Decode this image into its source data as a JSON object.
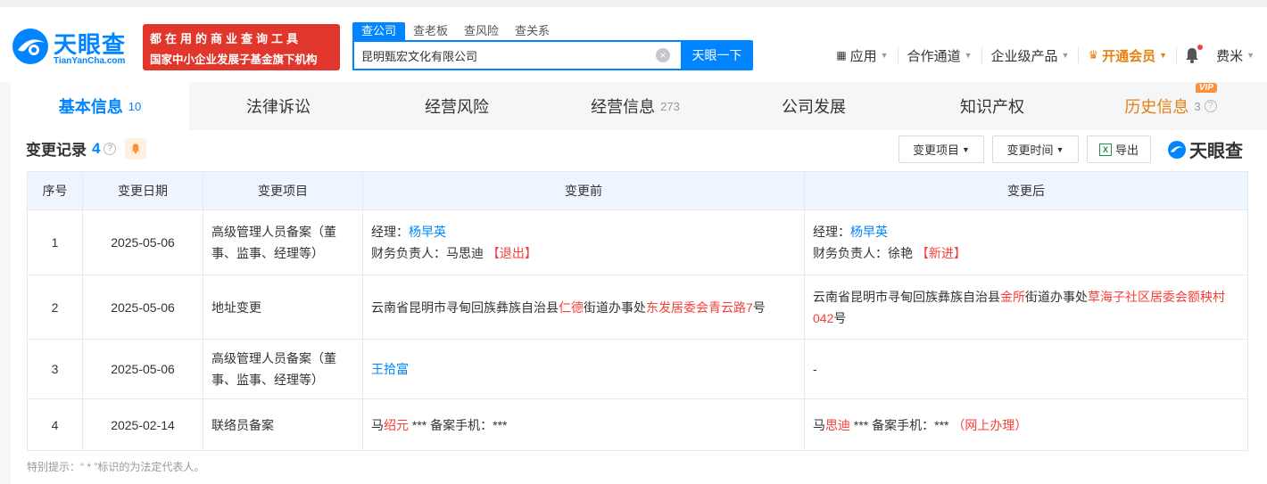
{
  "header": {
    "logo_text": "天眼查",
    "logo_sub": "TianYanCha.com",
    "banner_line1": "都在用的商业查询工具",
    "banner_line2": "国家中小企业发展子基金旗下机构",
    "search_tabs": [
      "查公司",
      "查老板",
      "查风险",
      "查关系"
    ],
    "search_value": "昆明甄宏文化有限公司",
    "search_button": "天眼一下",
    "nav": {
      "apps": "应用",
      "channel": "合作通道",
      "enterprise": "企业级产品",
      "vip": "开通会员",
      "user": "费米"
    }
  },
  "tabs": [
    {
      "label": "基本信息",
      "count": "10"
    },
    {
      "label": "法律诉讼",
      "count": ""
    },
    {
      "label": "经营风险",
      "count": ""
    },
    {
      "label": "经营信息",
      "count": "273"
    },
    {
      "label": "公司发展",
      "count": ""
    },
    {
      "label": "知识产权",
      "count": ""
    },
    {
      "label": "历史信息",
      "count": "3",
      "badge": "VIP"
    }
  ],
  "section": {
    "title": "变更记录",
    "count": "4",
    "filter1": "变更项目",
    "filter2": "变更时间",
    "export": "导出",
    "brand": "天眼查"
  },
  "table": {
    "headers": [
      "序号",
      "变更日期",
      "变更项目",
      "变更前",
      "变更后"
    ],
    "rows": [
      {
        "no": "1",
        "date": "2025-05-06",
        "item": "高级管理人员备案（董事、监事、经理等）",
        "before_l1_label": "经理：",
        "before_l1_name": "杨早英",
        "before_l2_label": "财务负责人：",
        "before_l2_name": "马思迪",
        "before_l2_tag": "【退出】",
        "after_l1_label": "经理：",
        "after_l1_name": "杨早英",
        "after_l2_label": "财务负责人：",
        "after_l2_name": "徐艳",
        "after_l2_tag": "【新进】"
      },
      {
        "no": "2",
        "date": "2025-05-06",
        "item": "地址变更",
        "before_p1": "云南省昆明市寻甸回族彝族自治县",
        "before_p2": "仁德",
        "before_p3": "街道办事处",
        "before_p4": "东发居委会青云路7",
        "before_p5": "号",
        "after_p1": "云南省昆明市寻甸回族彝族自治县",
        "after_p2": "金所",
        "after_p3": "街道办事处",
        "after_p4": "草海子社区居委会额秧村042",
        "after_p5": "号"
      },
      {
        "no": "3",
        "date": "2025-05-06",
        "item": "高级管理人员备案（董事、监事、经理等）",
        "before": "王拾富",
        "after": "-"
      },
      {
        "no": "4",
        "date": "2025-02-14",
        "item": "联络员备案",
        "before_p1": "马",
        "before_p2": "绍元",
        "before_p3": " *** 备案手机：***",
        "after_p1": "马",
        "after_p2": "思迪",
        "after_p3": " *** 备案手机：***",
        "after_p4": "（网上办理）"
      }
    ]
  },
  "note": "特别提示：“ * ”标识的为法定代表人。",
  "colors": {
    "accent": "#0084ff",
    "warn": "#f5413a",
    "vip": "#e4810f",
    "banner": "#e0362c"
  }
}
